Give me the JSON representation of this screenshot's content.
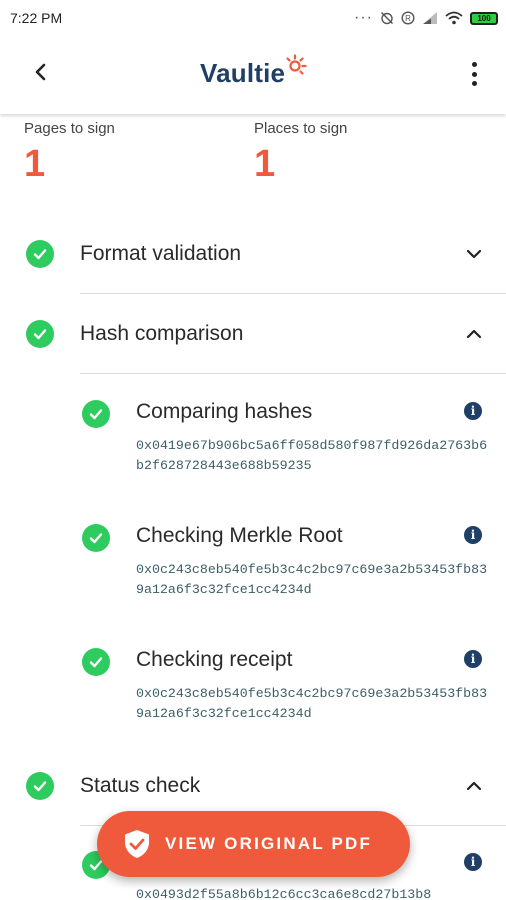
{
  "status_bar": {
    "time": "7:22 PM",
    "battery": "100"
  },
  "app": {
    "logo": "Vaultie"
  },
  "stats": {
    "pages_label": "Pages to sign",
    "pages_value": "1",
    "places_label": "Places to sign",
    "places_value": "1"
  },
  "sections": [
    {
      "title": "Format validation",
      "expanded": false
    },
    {
      "title": "Hash comparison",
      "expanded": true
    },
    {
      "title": "Status check",
      "expanded": true
    }
  ],
  "hash_items": [
    {
      "title": "Comparing hashes",
      "hash": "0x0419e67b906bc5a6ff058d580f987fd926da2763b6b2f628728443e688b59235"
    },
    {
      "title": "Checking Merkle Root",
      "hash": "0x0c243c8eb540fe5b3c4c2bc97c69e3a2b53453fb839a12a6f3c32fce1cc4234d"
    },
    {
      "title": "Checking receipt",
      "hash": "0x0c243c8eb540fe5b3c4c2bc97c69e3a2b53453fb839a12a6f3c32fce1cc4234d"
    }
  ],
  "status_items": [
    {
      "hash": "0x0493d2f55a8b6b12c6cc3ca6e8cd27b13b8"
    }
  ],
  "fab": {
    "label": "VIEW ORIGINAL PDF"
  },
  "colors": {
    "accent": "#f05a3c",
    "check": "#2ecc5f",
    "brand": "#1f3f66",
    "hash_text": "#3a5f66"
  }
}
